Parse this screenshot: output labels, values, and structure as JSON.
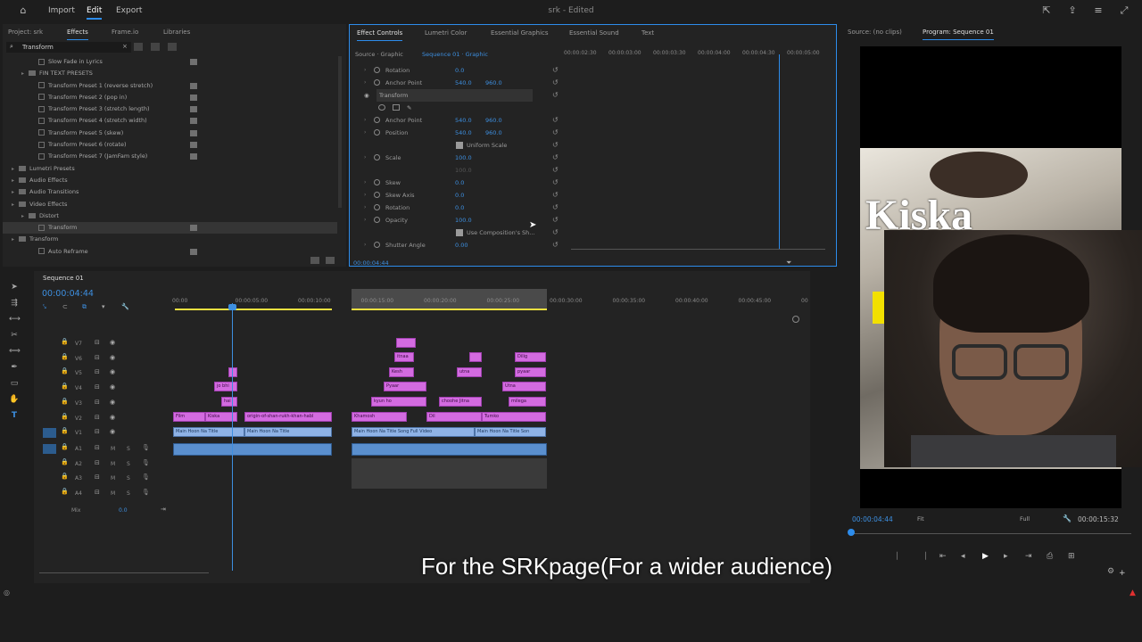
{
  "topbar": {
    "import": "Import",
    "edit": "Edit",
    "export": "Export",
    "title": "srk - Edited"
  },
  "leftpanel": {
    "tabs": [
      "Project: srk",
      "Effects",
      "Frame.io",
      "Libraries"
    ],
    "search_value": "Transform",
    "items": [
      {
        "label": "Slow Fade in Lyrics",
        "type": "fx",
        "indent": 2
      },
      {
        "label": "FIN TEXT PRESETS",
        "type": "folder",
        "indent": 1
      },
      {
        "label": "Transform Preset 1 (reverse stretch)",
        "type": "fx",
        "indent": 2
      },
      {
        "label": "Transform Preset 2 (pop in)",
        "type": "fx",
        "indent": 2
      },
      {
        "label": "Transform Preset 3 (stretch length)",
        "type": "fx",
        "indent": 2
      },
      {
        "label": "Transform Preset 4 (stretch width)",
        "type": "fx",
        "indent": 2
      },
      {
        "label": "Transform Preset 5 (skew)",
        "type": "fx",
        "indent": 2
      },
      {
        "label": "Transform Preset 6 (rotate)",
        "type": "fx",
        "indent": 2
      },
      {
        "label": "Transform Preset 7 (JamFam style)",
        "type": "fx",
        "indent": 2
      },
      {
        "label": "Lumetri Presets",
        "type": "folder",
        "indent": 0
      },
      {
        "label": "Audio Effects",
        "type": "folder",
        "indent": 0
      },
      {
        "label": "Audio Transitions",
        "type": "folder",
        "indent": 0
      },
      {
        "label": "Video Effects",
        "type": "folder",
        "indent": 0
      },
      {
        "label": "Distort",
        "type": "folder",
        "indent": 1
      },
      {
        "label": "Transform",
        "type": "fx",
        "indent": 2,
        "selected": true
      },
      {
        "label": "Transform",
        "type": "folder",
        "indent": 0
      },
      {
        "label": "Auto Reframe",
        "type": "fx",
        "indent": 2
      }
    ]
  },
  "effectcontrols": {
    "tabs": [
      "Effect Controls",
      "Lumetri Color",
      "Essential Graphics",
      "Essential Sound",
      "Text"
    ],
    "source": "Source · Graphic",
    "sequence": "Sequence 01 · Graphic",
    "ruler": [
      "00:00:02:30",
      "00:00:03:00",
      "00:00:03:30",
      "00:00:04:00",
      "00:00:04:30",
      "00:00:05:00"
    ],
    "rows": [
      {
        "label": "Rotation",
        "v1": "0.0",
        "v2": ""
      },
      {
        "label": "Anchor Point",
        "v1": "540.0",
        "v2": "960.0"
      },
      {
        "label": "Transform",
        "v1": "",
        "v2": ""
      },
      {
        "label": "",
        "v1": "",
        "v2": ""
      },
      {
        "label": "Anchor Point",
        "v1": "540.0",
        "v2": "960.0"
      },
      {
        "label": "Position",
        "v1": "540.0",
        "v2": "960.0"
      },
      {
        "label": "",
        "v1": "Uniform Scale",
        "v2": ""
      },
      {
        "label": "Scale",
        "v1": "100.0",
        "v2": ""
      },
      {
        "label": "",
        "v1": "100.0",
        "v2": ""
      },
      {
        "label": "Skew",
        "v1": "0.0",
        "v2": ""
      },
      {
        "label": "Skew Axis",
        "v1": "0.0",
        "v2": ""
      },
      {
        "label": "Rotation",
        "v1": "0.0",
        "v2": ""
      },
      {
        "label": "Opacity",
        "v1": "100.0",
        "v2": ""
      },
      {
        "label": "",
        "v1": "Use Composition's Sh...",
        "v2": ""
      },
      {
        "label": "Shutter Angle",
        "v1": "0.00",
        "v2": ""
      }
    ],
    "timecode": "00:00:04:44"
  },
  "source_tabs": [
    "Source: (no clips)",
    "Program: Sequence 01"
  ],
  "program": {
    "overlay_text": "Kiska",
    "timecode": "00:00:04:44",
    "fit": "Fit",
    "quality": "Full",
    "duration": "00:00:15:32"
  },
  "timeline": {
    "title": "Sequence 01",
    "timecode": "00:00:04:44",
    "ruler": [
      "00:00",
      "00:00:05:00",
      "00:00:10:00",
      "00:00:15:00",
      "00:00:20:00",
      "00:00:25:00",
      "00:00:30:00",
      "00:00:35:00",
      "00:00:40:00",
      "00:00:45:00",
      "00"
    ],
    "tracks": [
      "V7",
      "V6",
      "V5",
      "V4",
      "V3",
      "V2",
      "V1",
      "A1",
      "A2",
      "A3",
      "A4",
      "Mix"
    ],
    "mix_value": "0.0",
    "clips": {
      "v2a": "Film",
      "v2b": "Kiska",
      "v2c": "origin-of-shan-rukh-khan-habl",
      "v2d": "Khamosh",
      "v2e": "Dil",
      "v2f": "Tumko",
      "v3a": "hai",
      "v3b": "kyun ho",
      "v3c": "choohe Jitna",
      "v3d": "milega",
      "v4a": "jo bhi",
      "v4b": "Pyaar",
      "v4c": "Utna",
      "v5a": "Kesh",
      "v5b": "utna",
      "v5c": "pyaar",
      "v6a": "itnaa",
      "v7a": "",
      "v6b": "",
      "v6c": "Dilig",
      "v1a": "Main Hoon Na Title",
      "v1b": "Main Hoon Na Title",
      "v1c": "Main Hoon Na Title Song Full Video",
      "v1d": "Main Hoon Na Title Son"
    }
  },
  "subtitle": "For the SRKpage(For a wider audience)"
}
